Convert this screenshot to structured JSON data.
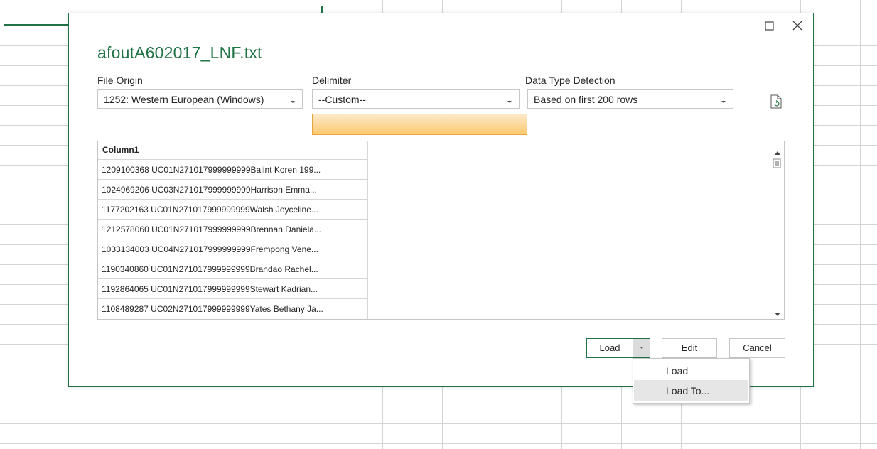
{
  "dialog": {
    "title": "afoutA602017_LNF.txt",
    "file_origin": {
      "label": "File Origin",
      "value": "1252: Western European (Windows)"
    },
    "delimiter": {
      "label": "Delimiter",
      "value": "--Custom--"
    },
    "data_type_detection": {
      "label": "Data Type Detection",
      "value": "Based on first 200 rows"
    },
    "preview": {
      "column_header": "Column1",
      "rows": [
        "1209100368 UC01N271017999999999Balint Koren 199...",
        "1024969206 UC03N271017999999999Harrison Emma...",
        "1177202163 UC01N271017999999999Walsh Joyceline...",
        "1212578060 UC01N271017999999999Brennan Daniela...",
        "1033134003 UC04N271017999999999Frempong Vene...",
        "1190340860 UC01N271017999999999Brandao Rachel...",
        "1192864065 UC01N271017999999999Stewart Kadrian...",
        "1108489287 UC02N271017999999999Yates Bethany Ja..."
      ]
    },
    "buttons": {
      "load": "Load",
      "edit": "Edit",
      "cancel": "Cancel"
    },
    "load_menu": {
      "items": [
        "Load",
        "Load To..."
      ]
    }
  },
  "colors": {
    "accent": "#217346",
    "tooltip_border": "#e8a43b",
    "tooltip_fill": "#fbc970"
  }
}
